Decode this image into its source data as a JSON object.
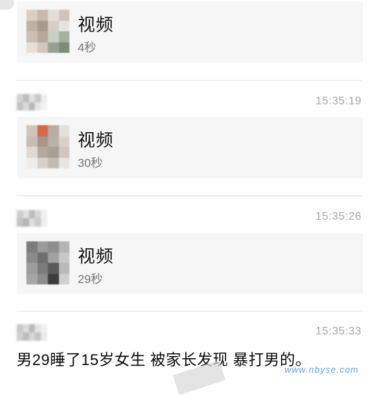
{
  "messages": [
    {
      "time": "",
      "video_label": "视频",
      "duration": "4秒"
    },
    {
      "time": "15:35:19",
      "video_label": "视频",
      "duration": "30秒"
    },
    {
      "time": "15:35:26",
      "video_label": "视频",
      "duration": "29秒"
    }
  ],
  "last_message": {
    "time": "15:35:33",
    "text": "男29睡了15岁女生 被家长发现 暴打男的。"
  },
  "watermark": "www.nbyse.com",
  "thumb_colors": [
    [
      "#d9cfc5",
      "#c6b8aa",
      "#e4ddd6",
      "#cfc4b9",
      "#bfb2a4",
      "#a89a8c",
      "#d6cec6",
      "#e8e3de",
      "#cdbfb1",
      "#b7a99b",
      "#c8d0c2",
      "#a7b09f",
      "#e6e0d8",
      "#d2c8bc",
      "#9aa095",
      "#7d8a76"
    ],
    [
      "#cfc5bd",
      "#d7674a",
      "#b9aca2",
      "#e6e0da",
      "#c7bdb6",
      "#a5968c",
      "#bdb0a6",
      "#d9d2cb",
      "#e0d9d2",
      "#b5a89e",
      "#a9a095",
      "#cfc7bf",
      "#f0ece8",
      "#d8d1ca",
      "#c4bbb2",
      "#e9e4df"
    ],
    [
      "#7c7c7c",
      "#9a9a9a",
      "#8e8e8e",
      "#b4b4b4",
      "#8a8a8a",
      "#6e6e6e",
      "#a1a1a1",
      "#c7c7c7",
      "#9c9c9c",
      "#7a7a7a",
      "#5a5a5a",
      "#b9b9b9",
      "#a6a6a6",
      "#8c8c8c",
      "#3d3d3d",
      "#d0d0d0"
    ]
  ]
}
